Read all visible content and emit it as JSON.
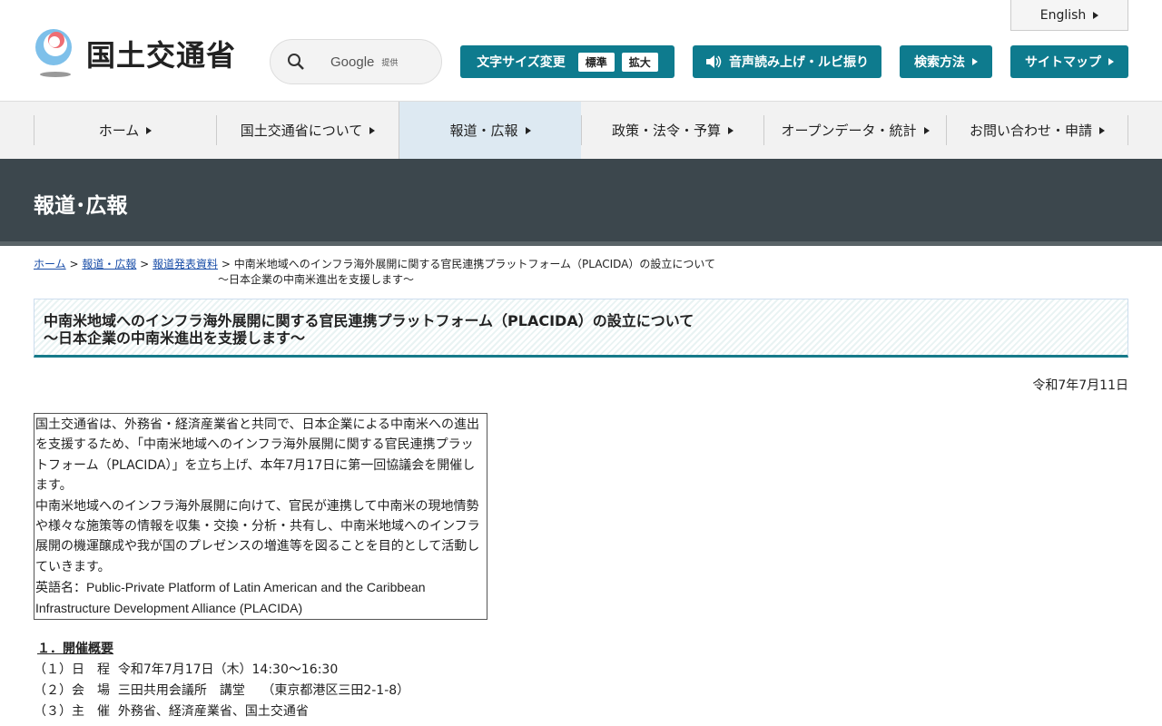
{
  "header": {
    "logo_text": "国土交通省",
    "search_brand": "Google",
    "search_provided": "提供",
    "english": "English",
    "font_size_label": "文字サイズ変更",
    "font_standard": "標準",
    "font_large": "拡大",
    "speech": "音声読み上げ・ルビ振り",
    "search_method": "検索方法",
    "sitemap": "サイトマップ"
  },
  "nav": [
    "ホーム",
    "国土交通省について",
    "報道・広報",
    "政策・法令・予算",
    "オープンデータ・統計",
    "お問い合わせ・申請"
  ],
  "banner": "報道･広報",
  "breadcrumb": {
    "home": "ホーム",
    "press": "報道・広報",
    "release": "報道発表資料",
    "current1": "中南米地域へのインフラ海外展開に関する官民連携プラットフォーム（PLACIDA）の設立について",
    "current2": "～日本企業の中南米進出を支援します～"
  },
  "title": {
    "line1": "中南米地域へのインフラ海外展開に関する官民連携プラットフォーム（PLACIDA）の設立について",
    "line2": "～日本企業の中南米進出を支援します～"
  },
  "date": "令和7年7月11日",
  "intro": {
    "p1": "国土交通省は、外務省・経済産業省と共同で、日本企業による中南米への進出を支援するため、「中南米地域へのインフラ海外展開に関する官民連携プラットフォーム（PLACIDA）」を立ち上げ、本年7月17日に第一回協議会を開催します。",
    "p2": "中南米地域へのインフラ海外展開に向けて、官民が連携して中南米の現地情勢や様々な施策等の情報を収集・交換・分析・共有し、中南米地域へのインフラ展開の機運醸成や我が国のプレゼンスの増進等を図ることを目的として活動していきます。",
    "p3": "英語名：Public-Private Platform of Latin American and the Caribbean Infrastructure Development Alliance (PLACIDA)"
  },
  "section": {
    "heading": "１．開催概要",
    "items": [
      "（１）日　程  令和7年7月17日（木）14:30～16:30",
      "（２）会　場  三田共用会議所　講堂　 （東京都港区三田2-1-8）",
      "（３）主　催  外務省、経済産業省、国土交通省"
    ]
  }
}
